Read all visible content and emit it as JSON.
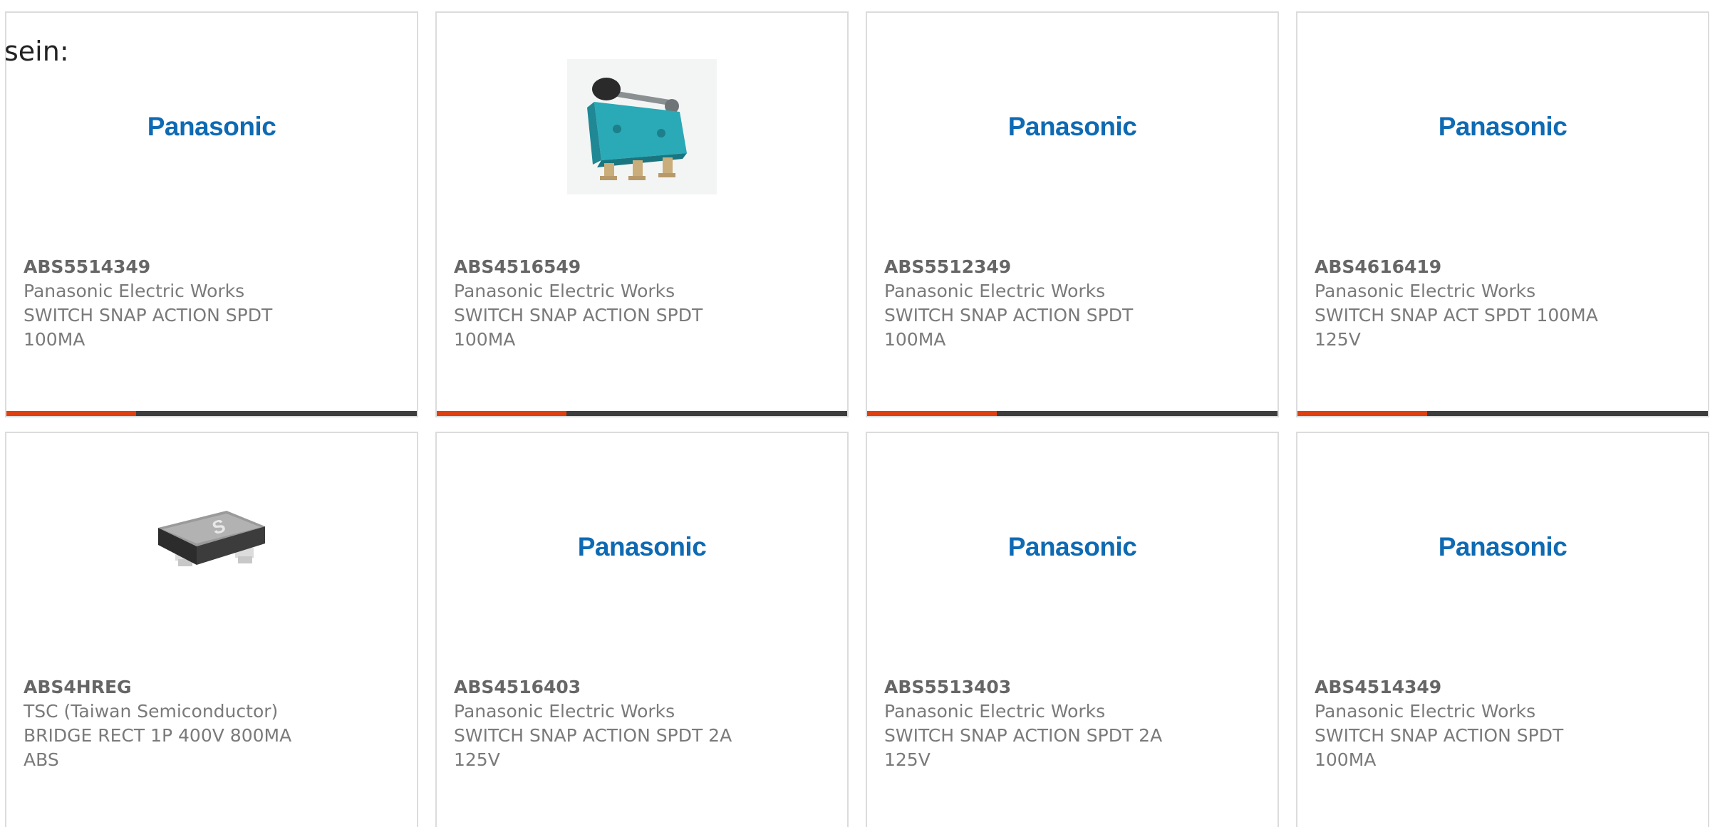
{
  "heading": "sein:",
  "colors": {
    "accent": "#e0400f",
    "bar": "#3d3d3d",
    "brand_logo": "#0e6ab3",
    "card_border": "#dcdcdc"
  },
  "products": [
    {
      "part_number": "ABS5514349",
      "manufacturer": "Panasonic Electric Works",
      "description": "SWITCH SNAP ACTION SPDT 100MA",
      "image": "panasonic-logo",
      "logo_text": "Panasonic"
    },
    {
      "part_number": "ABS4516549",
      "manufacturer": "Panasonic Electric Works",
      "description": "SWITCH SNAP ACTION SPDT 100MA",
      "image": "snap-switch-photo",
      "logo_text": ""
    },
    {
      "part_number": "ABS5512349",
      "manufacturer": "Panasonic Electric Works",
      "description": "SWITCH SNAP ACTION SPDT 100MA",
      "image": "panasonic-logo",
      "logo_text": "Panasonic"
    },
    {
      "part_number": "ABS4616419",
      "manufacturer": "Panasonic Electric Works",
      "description": "SWITCH SNAP ACT SPDT 100MA 125V",
      "image": "panasonic-logo",
      "logo_text": "Panasonic"
    },
    {
      "part_number": "ABS4HREG",
      "manufacturer": "TSC (Taiwan Semiconductor)",
      "description": "BRIDGE RECT 1P 400V 800MA ABS",
      "image": "bridge-rectifier-photo",
      "logo_text": ""
    },
    {
      "part_number": "ABS4516403",
      "manufacturer": "Panasonic Electric Works",
      "description": "SWITCH SNAP ACTION SPDT 2A 125V",
      "image": "panasonic-logo",
      "logo_text": "Panasonic"
    },
    {
      "part_number": "ABS5513403",
      "manufacturer": "Panasonic Electric Works",
      "description": "SWITCH SNAP ACTION SPDT 2A 125V",
      "image": "panasonic-logo",
      "logo_text": "Panasonic"
    },
    {
      "part_number": "ABS4514349",
      "manufacturer": "Panasonic Electric Works",
      "description": "SWITCH SNAP ACTION SPDT 100MA",
      "image": "panasonic-logo",
      "logo_text": "Panasonic"
    }
  ]
}
